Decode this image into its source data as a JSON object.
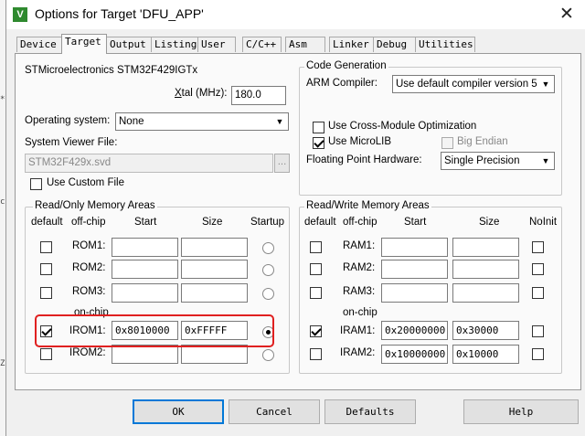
{
  "window": {
    "title": "Options for Target 'DFU_APP'",
    "close": "✕",
    "icon_letter": "V"
  },
  "left_strip": {
    "marks": [
      "*",
      "c",
      "Z"
    ]
  },
  "tabs": [
    {
      "label": "Device"
    },
    {
      "label": "Target"
    },
    {
      "label": "Output"
    },
    {
      "label": "Listing"
    },
    {
      "label": "User"
    },
    {
      "label": "C/C++"
    },
    {
      "label": "Asm"
    },
    {
      "label": "Linker"
    },
    {
      "label": "Debug"
    },
    {
      "label": "Utilities"
    }
  ],
  "target": {
    "device_name": "STMicroelectronics STM32F429IGTx",
    "xtal_label_x": "X",
    "xtal_label_rest": "tal (MHz):",
    "xtal_value": "180.0",
    "os_label": "Operating system:",
    "os_value": "None",
    "svd_label": "System Viewer File:",
    "svd_value": "STM32F429x.svd",
    "svd_browse": "...",
    "use_custom_file": "Use Custom File"
  },
  "codegen": {
    "title": "Code Generation",
    "compiler_label": "ARM Compiler:",
    "compiler_value": "Use default compiler version 5",
    "cross_module": "Use Cross-Module Optimization",
    "microlib": "Use MicroLIB",
    "big_endian": "Big Endian",
    "fp_label": "Floating Point Hardware:",
    "fp_value": "Single Precision"
  },
  "rom": {
    "title": "Read/Only Memory Areas",
    "headers": {
      "default": "default",
      "offchip": "off-chip",
      "start": "Start",
      "size": "Size",
      "startup": "Startup"
    },
    "onchip_label": "on-chip",
    "rows": [
      {
        "name": "ROM1:",
        "start": "",
        "size": ""
      },
      {
        "name": "ROM2:",
        "start": "",
        "size": ""
      },
      {
        "name": "ROM3:",
        "start": "",
        "size": ""
      },
      {
        "name": "IROM1:",
        "start": "0x8010000",
        "size": "0xFFFFF"
      },
      {
        "name": "IROM2:",
        "start": "",
        "size": ""
      }
    ]
  },
  "ram": {
    "title": "Read/Write Memory Areas",
    "headers": {
      "default": "default",
      "offchip": "off-chip",
      "start": "Start",
      "size": "Size",
      "noinit": "NoInit"
    },
    "onchip_label": "on-chip",
    "rows": [
      {
        "name": "RAM1:",
        "start": "",
        "size": ""
      },
      {
        "name": "RAM2:",
        "start": "",
        "size": ""
      },
      {
        "name": "RAM3:",
        "start": "",
        "size": ""
      },
      {
        "name": "IRAM1:",
        "start": "0x20000000",
        "size": "0x30000"
      },
      {
        "name": "IRAM2:",
        "start": "0x10000000",
        "size": "0x10000"
      }
    ]
  },
  "buttons": {
    "ok": "OK",
    "cancel": "Cancel",
    "defaults": "Defaults",
    "help": "Help"
  },
  "colors": {
    "highlight": "#e02020",
    "default_button_border": "#0078d7"
  }
}
